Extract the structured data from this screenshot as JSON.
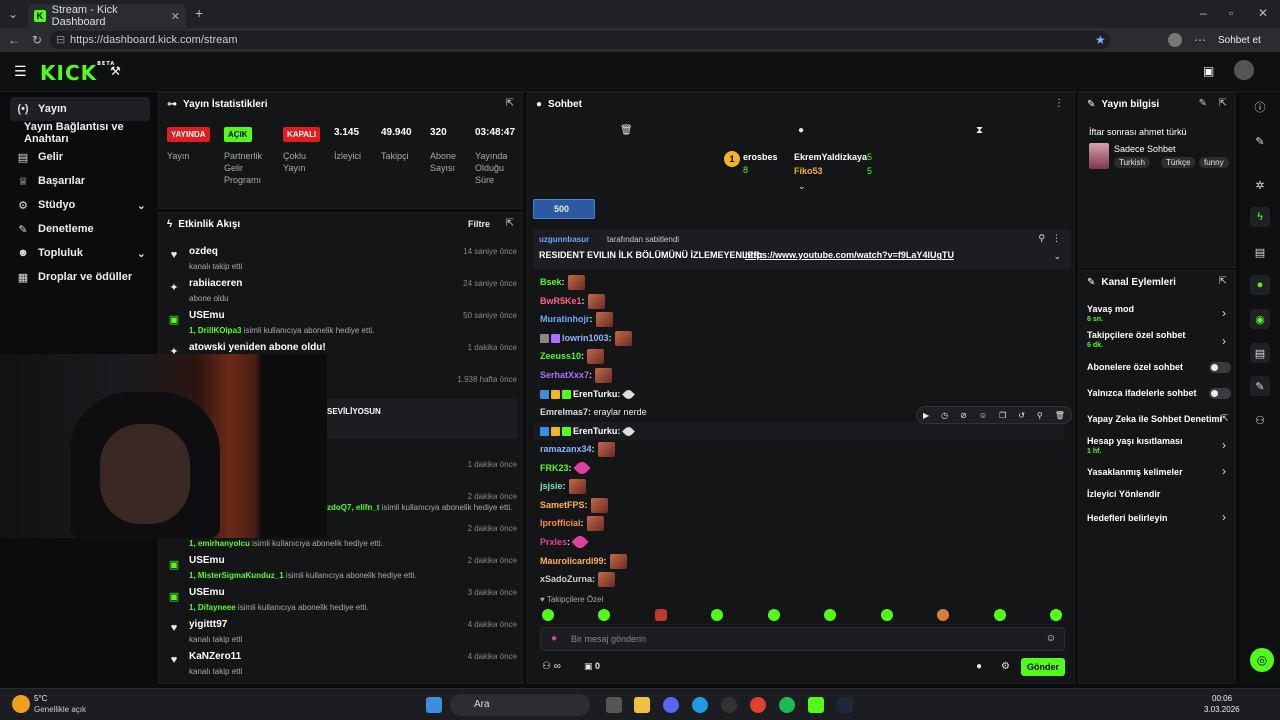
{
  "browser": {
    "tab_title": "Stream - Kick Dashboard",
    "url": "https://dashboard.kick.com/stream",
    "sohbet_label": "Sohbet et"
  },
  "header": {
    "logo": "KICK",
    "beta": "BETA"
  },
  "sidebar": {
    "items": [
      {
        "label": "Yayın",
        "icon": "broadcast-icon"
      },
      {
        "label": "Yayın Bağlantısı ve Anahtarı",
        "icon": ""
      },
      {
        "label": "Gelir",
        "icon": "wallet-icon"
      },
      {
        "label": "Başarılar",
        "icon": "trophy-icon"
      },
      {
        "label": "Stüdyo",
        "icon": "studio-icon"
      },
      {
        "label": "Denetleme",
        "icon": "wrench-icon"
      },
      {
        "label": "Topluluk",
        "icon": "users-icon"
      },
      {
        "label": "Droplar ve ödüller",
        "icon": "gift-icon"
      }
    ]
  },
  "stats": {
    "title": "Yayın İstatistikleri",
    "badges": [
      {
        "value": "YAYINDA",
        "label": "Yayın",
        "color": "#e11d1d"
      },
      {
        "value": "AÇIK",
        "label": "Partnerlik Gelir Programı",
        "color": "#53fc18"
      },
      {
        "value": "KAPALI",
        "label": "Çoklu Yayın",
        "color": "#e11d1d"
      }
    ],
    "numbers": [
      {
        "value": "3.145",
        "label": "İzleyici"
      },
      {
        "value": "49.940",
        "label": "Takipçi"
      },
      {
        "value": "320",
        "label": "Abone Sayısı"
      },
      {
        "value": "03:48:47",
        "label": "Yayında Olduğu Süre"
      }
    ]
  },
  "activity": {
    "title": "Etkinlik Akışı",
    "filter": "Filtre",
    "items": [
      {
        "name": "ozdeq",
        "sub": "kanalı takip etti",
        "time": "14 saniye önce",
        "icon": "heart-icon"
      },
      {
        "name": "rabiiaceren",
        "sub": "abone oldu",
        "time": "24 saniye önce",
        "icon": "star-icon"
      },
      {
        "name": "USEmu",
        "sub_hl": "1, DrillKOlpa3",
        "sub": " isimli kullanıcıya abonelik hediye etti.",
        "time": "50 saniye önce",
        "icon": "gift-icon"
      },
      {
        "name": "atowski yeniden abone oldu!",
        "sub": "",
        "time": "1 dakika önce",
        "icon": "star-icon"
      },
      {
        "name": "",
        "sub": "",
        "time": "1.938 hafta önce",
        "icon": ""
      },
      {
        "name": "SEVİLİYOSUN",
        "sub": "",
        "time": "",
        "icon": ""
      },
      {
        "name": "",
        "sub": "",
        "time": "1 dakika önce",
        "icon": ""
      },
      {
        "name": "",
        "sub_hl": "zdoQ7, elifn_t",
        "sub": " isimli kullanıcıya abonelik hediye etti.",
        "time": "2 dakika önce",
        "icon": ""
      },
      {
        "name": "",
        "sub_hl": "1, emirhanyolcu",
        "sub": " isimli kullanıcıya abonelik hediye etti.",
        "time": "2 dakika önce",
        "icon": ""
      },
      {
        "name": "USEmu",
        "sub_hl": "1, MisterSigmaKunduz_1",
        "sub": " isimli kullanıcıya abonelik hediye etti.",
        "time": "2 dakika önce",
        "icon": "gift-icon"
      },
      {
        "name": "USEmu",
        "sub_hl": "1, Difayneee",
        "sub": " isimli kullanıcıya abonelik hediye etti.",
        "time": "3 dakika önce",
        "icon": "gift-icon"
      },
      {
        "name": "yigittt97",
        "sub": "kanalı takip etti",
        "time": "4 dakika önce",
        "icon": "heart-icon"
      },
      {
        "name": "KaNZero11",
        "sub": "kanalı takip etti",
        "time": "4 dakika önce",
        "icon": "heart-icon"
      }
    ]
  },
  "chat": {
    "title": "Sohbet",
    "leaders": [
      {
        "name": "erosbes",
        "count": "8"
      },
      {
        "name": "EkremYaldizkaya",
        "count": "5"
      },
      {
        "name": "Fiko53",
        "count": "5"
      }
    ],
    "goal_value": "500",
    "pinned": {
      "by": "uzgunnbasur",
      "by_suffix": "tarafından sabitlendi",
      "text": "RESIDENT EVILIN İLK BÖLÜMÜNÜ İZLEMEYENLER:",
      "link": "https://www.youtube.com/watch?v=f9LaY4lUgTU"
    },
    "messages": [
      {
        "user": "Bsek",
        "color": "#53fc18",
        "text": "",
        "emote": "emote"
      },
      {
        "user": "BwR5Ke1",
        "color": "#ff5f8a",
        "text": "",
        "emote": "emote"
      },
      {
        "user": "Muratinhojr",
        "color": "#6aa8ff",
        "text": "",
        "emote": "emote"
      },
      {
        "user": "lowrin1003",
        "color": "#8fb4ff",
        "text": "",
        "emote": "emote"
      },
      {
        "user": "Zeeuss10",
        "color": "#53fc18",
        "text": "",
        "emote": "emote"
      },
      {
        "user": "SerhatXxx7",
        "color": "#b070ff",
        "text": "",
        "emote": "emote"
      },
      {
        "user": "ErenTurku",
        "color": "#fff",
        "text": "",
        "emote": "feather-w"
      },
      {
        "user": "Emrelmas7",
        "color": "#ddd",
        "text": "eraylar nerde",
        "emote": ""
      },
      {
        "user": "ErenTurku",
        "color": "#fff",
        "text": "",
        "emote": "feather-w"
      },
      {
        "user": "ramazanx34",
        "color": "#8fb4ff",
        "text": "",
        "emote": "emote"
      },
      {
        "user": "FRK23",
        "color": "#53fc18",
        "text": "",
        "emote": "feather"
      },
      {
        "user": "jsjsie",
        "color": "#6ee7c7",
        "text": "",
        "emote": "emote"
      },
      {
        "user": "SametFPS",
        "color": "#ffb347",
        "text": "",
        "emote": "emote"
      },
      {
        "user": "lprofficial",
        "color": "#ff8a3d",
        "text": "",
        "emote": "emote"
      },
      {
        "user": "Prxles",
        "color": "#e040a0",
        "text": "",
        "emote": "feather"
      },
      {
        "user": "Maurolicardi99",
        "color": "#ffb347",
        "text": "",
        "emote": "emote"
      },
      {
        "user": "xSadoZurna",
        "color": "#ccc",
        "text": "",
        "emote": "emote"
      }
    ],
    "followers_only": "Takipçilere Özel",
    "input_placeholder": "Bir mesaj gönderin",
    "send_label": "Gönder",
    "counter": "0"
  },
  "stream_info": {
    "title": "Yayın bilgisi",
    "stream_title": "İftar sonrası ahmet türkü",
    "category": "Sadece Sohbet",
    "tags": [
      "Turkish",
      "Türkçe",
      "funny"
    ]
  },
  "channel_actions": {
    "title": "Kanal Eylemleri",
    "items": [
      {
        "label": "Yavaş mod",
        "sub": "6 sn.",
        "control": "chevron"
      },
      {
        "label": "Takipçilere özel sohbet",
        "sub": "6 dk.",
        "control": "chevron"
      },
      {
        "label": "Abonelere özel sohbet",
        "sub": "",
        "control": "toggle"
      },
      {
        "label": "Yalnızca ifadelerle sohbet",
        "sub": "",
        "control": "toggle"
      },
      {
        "label": "Yapay Zeka ile Sohbet Denetimi",
        "sub": "",
        "control": "external"
      },
      {
        "label": "Hesap yaşı kısıtlaması",
        "sub": "1 hf.",
        "control": "chevron"
      },
      {
        "label": "Yasaklanmış kelimeler",
        "sub": "",
        "control": "chevron"
      },
      {
        "label": "İzleyici Yönlendir",
        "sub": "",
        "control": ""
      },
      {
        "label": "Hedefleri belirleyin",
        "sub": "",
        "control": "chevron"
      }
    ]
  },
  "taskbar": {
    "weather_temp": "5°C",
    "weather_text": "Genellikle açık",
    "search": "Ara",
    "time": "00:06",
    "date": "3.03.2026"
  }
}
